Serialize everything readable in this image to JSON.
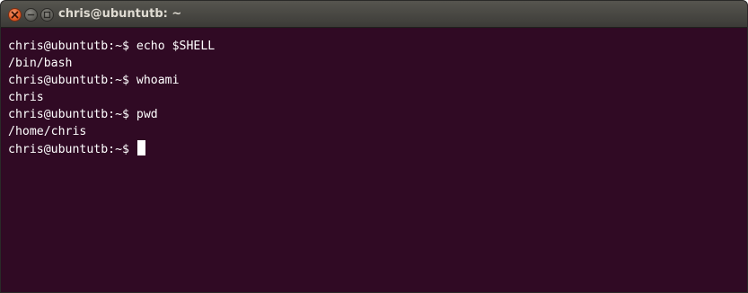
{
  "window": {
    "title": "chris@ubuntutb: ~",
    "controls": [
      "close-icon",
      "minimize-icon",
      "maximize-icon"
    ]
  },
  "terminal": {
    "background_color": "#300a24",
    "text_color": "#ffffff",
    "lines": [
      "chris@ubuntutb:~$ echo $SHELL",
      "/bin/bash",
      "chris@ubuntutb:~$ whoami",
      "chris",
      "chris@ubuntutb:~$ pwd",
      "/home/chris"
    ],
    "current_prompt": "chris@ubuntutb:~$ "
  }
}
